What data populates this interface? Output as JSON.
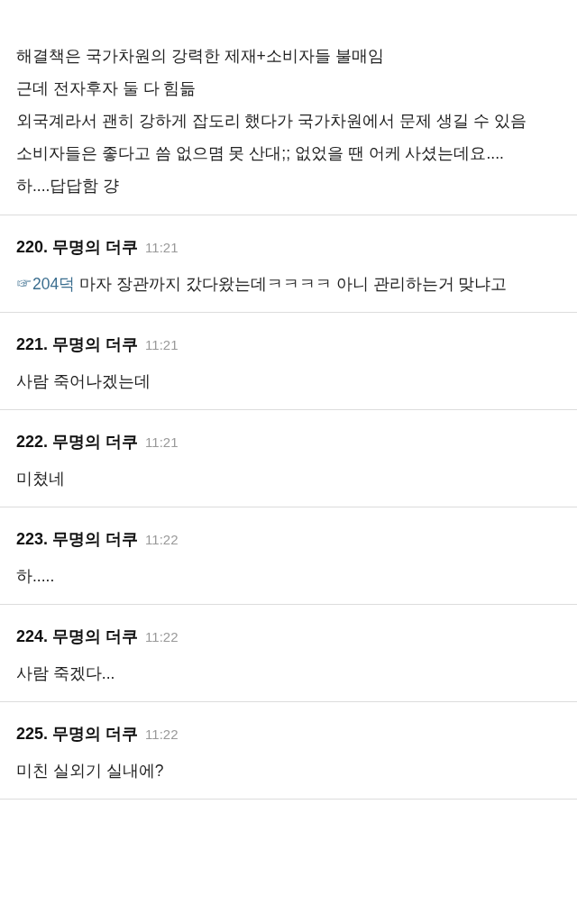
{
  "intro": {
    "lines": [
      "해결책은 국가차원의 강력한 제재+소비자들 불매임",
      "근데 전자후자 둘 다 힘듦",
      "외국계라서 괜히 강하게 잡도리 했다가 국가차원에서 문제 생길 수 있음",
      "소비자들은 좋다고 씀 없으몀 못 산대;; 없었을 땐 어케 사셨는데요....",
      "하....답답함 걍"
    ]
  },
  "comments": [
    {
      "number": "220.",
      "author": "무명의 더쿠",
      "time": "11:21",
      "anchor": "☞204덕",
      "text": " 마자 장관까지 갔다왔는데ㅋㅋㅋㅋ 아니 관리하는거 맞냐고"
    },
    {
      "number": "221.",
      "author": "무명의 더쿠",
      "time": "11:21",
      "text": "사람 죽어나겠는데"
    },
    {
      "number": "222.",
      "author": "무명의 더쿠",
      "time": "11:21",
      "text": "미쳤네"
    },
    {
      "number": "223.",
      "author": "무명의 더쿠",
      "time": "11:22",
      "text": "하....."
    },
    {
      "number": "224.",
      "author": "무명의 더쿠",
      "time": "11:22",
      "text": "사람 죽겠다..."
    },
    {
      "number": "225.",
      "author": "무명의 더쿠",
      "time": "11:22",
      "text": "미친 실외기 실내에?"
    }
  ]
}
